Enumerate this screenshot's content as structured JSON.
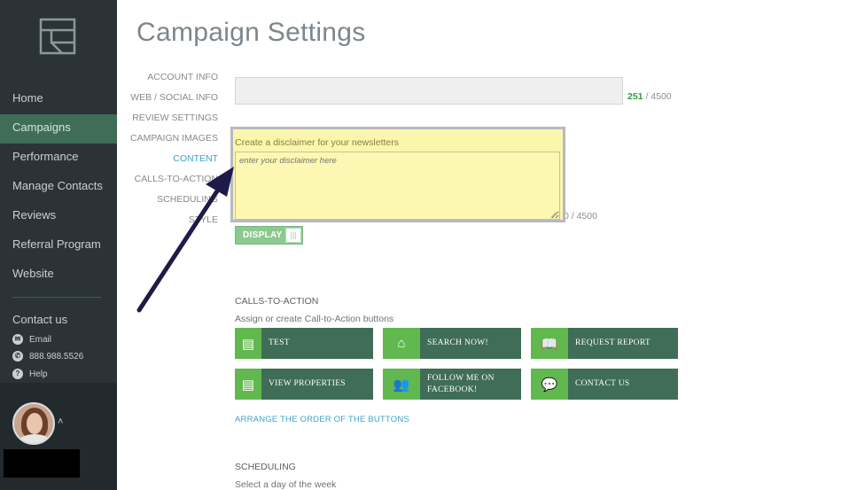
{
  "colors": {
    "sidebar_bg": "#2b3338",
    "active_nav": "#3f6d57",
    "cta_button": "#3f6d57",
    "cta_icon": "#60b84e",
    "link": "#3ba4c9",
    "highlight_box": "#fbf6ad",
    "annotation_arrow": "#1e1b48"
  },
  "sidebar": {
    "logo_icon": "window-layout-icon",
    "nav_items": [
      {
        "label": "Home"
      },
      {
        "label": "Campaigns",
        "active": true
      },
      {
        "label": "Performance"
      },
      {
        "label": "Manage Contacts"
      },
      {
        "label": "Reviews"
      },
      {
        "label": "Referral Program"
      },
      {
        "label": "Website"
      }
    ],
    "contact": {
      "title": "Contact us",
      "email": "Email",
      "phone": "888.988.5526",
      "help": "Help"
    }
  },
  "page": {
    "title": "Campaign Settings"
  },
  "sub_nav": [
    {
      "label": "ACCOUNT INFO"
    },
    {
      "label": "WEB / SOCIAL INFO"
    },
    {
      "label": "REVIEW SETTINGS"
    },
    {
      "label": "CAMPAIGN IMAGES"
    },
    {
      "label": "CONTENT",
      "active": true
    },
    {
      "label": "CALLS-TO-ACTION"
    },
    {
      "label": "SCHEDULING"
    },
    {
      "label": "STYLE"
    }
  ],
  "content": {
    "counter1_current": "251",
    "counter1_max": " / 4500",
    "disclaimer_label": "Create a disclaimer for your newsletters",
    "disclaimer_placeholder": "enter your disclaimer here",
    "counter2": "0 / 4500",
    "display_toggle": "DISPLAY"
  },
  "cta": {
    "title": "CALLS-TO-ACTION",
    "subtitle": "Assign or create Call-to-Action buttons",
    "buttons": [
      {
        "label": "TEST",
        "icon": "document-icon"
      },
      {
        "label": "SEARCH NOW!",
        "icon": "house-icon"
      },
      {
        "label": "REQUEST REPORT",
        "icon": "report-book-icon"
      },
      {
        "label": "VIEW PROPERTIES",
        "icon": "document-icon"
      },
      {
        "label": "FOLLOW ME ON FACEBOOK!",
        "label_line1": "FOLLOW ME ON",
        "label_line2": "FACEBOOK!",
        "icon": "people-icon"
      },
      {
        "label": "CONTACT US",
        "icon": "speech-bubbles-icon"
      }
    ],
    "arrange_link": "ARRANGE THE ORDER OF THE BUTTONS"
  },
  "scheduling": {
    "title": "SCHEDULING",
    "subtitle": "Select a day of the week"
  }
}
